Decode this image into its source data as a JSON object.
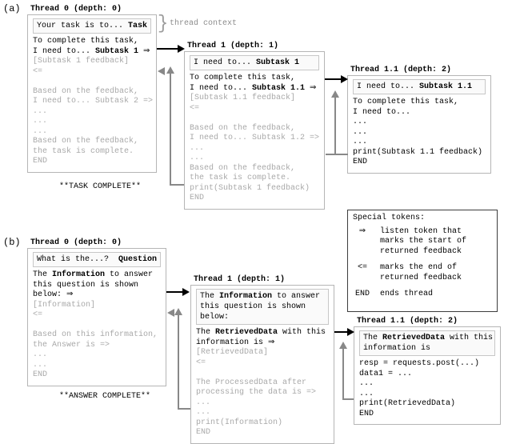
{
  "sectionA": {
    "tag": "(a)",
    "t0": {
      "title": "Thread 0 (depth: 0)",
      "ctx": "Your task is to... <b>Task</b>",
      "body": "To complete this task,\nI need to... <b>Subtask 1</b> ⇒\n<span class='grey'>[Subtask 1 feedback]</span>\n<span class='grey'>&lt;=</span>\n\n<span class='grey'>Based on the feedback,</span>\n<span class='grey'>I need to... Subtask 2 =&gt;</span>\n<span class='grey'>...</span>\n<span class='grey'>...</span>\n<span class='grey'>...</span>\n<span class='grey'>Based on the feedback,</span>\n<span class='grey'>the task is complete.</span>\n<span class='grey'>END</span>",
      "footer": "**TASK COMPLETE**"
    },
    "t1": {
      "title": "Thread 1 (depth: 1)",
      "ctx": "I need to... <b>Subtask 1</b>",
      "body": "To complete this task,\nI need to... <b>Subtask 1.1</b> ⇒\n<span class='grey'>[Subtask 1.1 feedback]</span>\n<span class='grey'>&lt;=</span>\n\n<span class='grey'>Based on the feedback,</span>\n<span class='grey'>I need to... Subtask 1.2 =&gt;</span>\n<span class='grey'>...</span>\n<span class='grey'>...</span>\n<span class='grey'>Based on the feedback,</span>\n<span class='grey'>the task is complete.</span>\n<span class='grey'>print(Subtask 1 feedback)</span>\n<span class='grey'>END</span>"
    },
    "t11": {
      "title": "Thread 1.1 (depth: 2)",
      "ctx": "I need to... <b>Subtask 1.1</b>",
      "body": "To complete this task,\nI need to...\n...\n...\n...\nprint(Subtask 1.1 feedback)\nEND"
    },
    "contextLabel": "thread context"
  },
  "sectionB": {
    "tag": "(b)",
    "t0": {
      "title": "Thread 0 (depth: 0)",
      "ctx": "What is the...?  <b>Question</b>",
      "body": "The <b>Information</b> to answer\nthis question is shown\nbelow: ⇒\n<span class='grey'>[Information]</span>\n<span class='grey'>&lt;=</span>\n\n<span class='grey'>Based on this information,</span>\n<span class='grey'>the Answer is =&gt;</span>\n<span class='grey'>...</span>\n<span class='grey'>...</span>\n<span class='grey'>END</span>",
      "footer": "**ANSWER COMPLETE**"
    },
    "t1": {
      "title": "Thread 1 (depth: 1)",
      "ctx": "The <b>Information</b> to answer\nthis question is shown\nbelow:",
      "body": "The <b>RetrievedData</b> with this\ninformation is ⇒\n<span class='grey'>[RetrievedData]</span>\n<span class='grey'>&lt;=</span>\n\n<span class='grey'>The ProcessedData after</span>\n<span class='grey'>processing the data is =&gt;</span>\n<span class='grey'>...</span>\n<span class='grey'>...</span>\n<span class='grey'>print(Information)</span>\n<span class='grey'>END</span>"
    },
    "t11": {
      "title": "Thread 1.1 (depth: 2)",
      "ctx": "The <b>RetrievedData</b> with this\ninformation is",
      "body": "resp = requests.post(...)\ndata1 = ...\n...\n...\nprint(RetrievedData)\nEND"
    }
  },
  "legend": {
    "title": "Special tokens:",
    "rows": [
      {
        "sym": "⇒",
        "desc": "listen token that\nmarks the start of\nreturned feedback"
      },
      {
        "sym": "<=",
        "desc": "marks the end of\nreturned feedback"
      },
      {
        "sym": "END",
        "desc": "ends thread"
      }
    ]
  }
}
